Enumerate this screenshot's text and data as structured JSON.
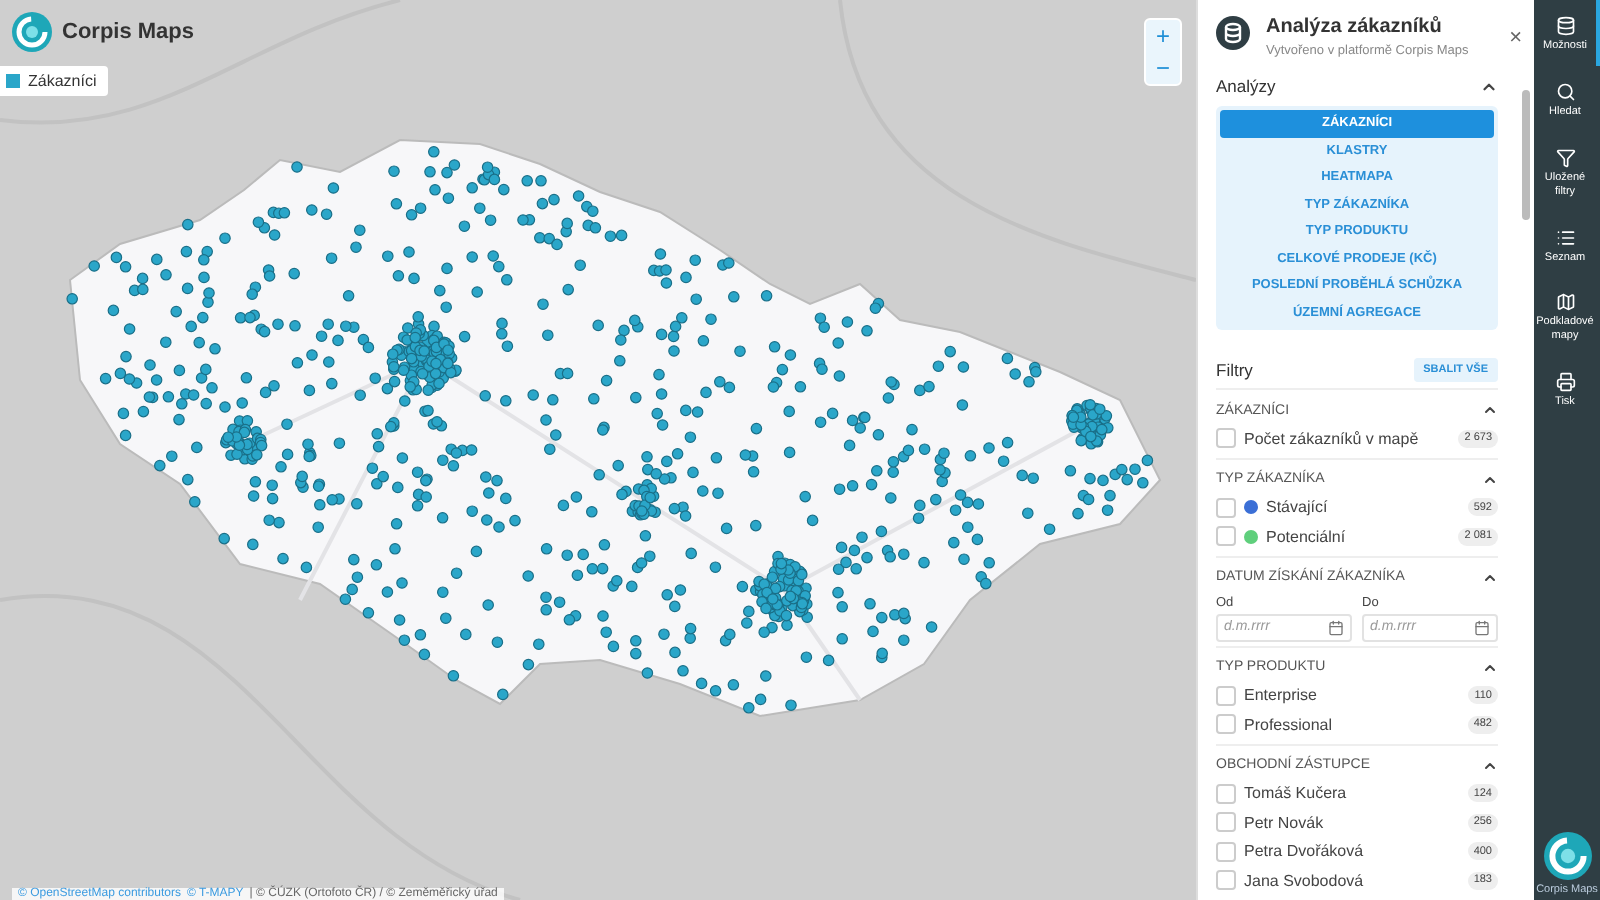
{
  "app": {
    "name": "Corpis Maps"
  },
  "legend": [
    {
      "label": "Zákazníci"
    }
  ],
  "zoom_controls": [
    "+",
    "−"
  ],
  "attribution": [
    {
      "text": "© OpenStreetMap contributors",
      "kind": "link"
    },
    {
      "text": "© T-MAPY",
      "kind": "link"
    },
    {
      "text": "| © ČÚZK (Ortofoto ČR) / © Zeměměřický úřad",
      "kind": "plain"
    }
  ],
  "panel": {
    "title": "Analýza zákazníků",
    "subtitle": "Vytvořeno v platformě Corpis Maps",
    "close": "×"
  },
  "analyses": {
    "title": "Analýzy",
    "expanded": true,
    "items": [
      {
        "label": "ZÁKAZNÍCI",
        "selected": true
      },
      {
        "label": "KLASTRY",
        "selected": false
      },
      {
        "label": "HEATMAPA",
        "selected": false
      },
      {
        "label": "TYP ZÁKAZNÍKA",
        "selected": false
      },
      {
        "label": "TYP PRODUKTU",
        "selected": false
      },
      {
        "label": "CELKOVÉ PRODEJE (KČ)",
        "selected": false
      },
      {
        "label": "POSLEDNÍ PROBĚHLÁ SCHŮZKA",
        "selected": false
      },
      {
        "label": "ÚZEMNÍ AGREGACE",
        "selected": false
      }
    ]
  },
  "filters": {
    "title": "Filtry",
    "collapse_all": "SBALIT VŠE",
    "groups": [
      {
        "kind": "checklist",
        "title": "ZÁKAZNÍCI",
        "expanded": true,
        "items": [
          {
            "label": "Počet zákazníků v mapě",
            "count": "2 673",
            "checked": false
          }
        ]
      },
      {
        "kind": "checklist",
        "title": "TYP ZÁKAZNÍKA",
        "expanded": true,
        "items": [
          {
            "label": "Stávající",
            "count": "592",
            "checked": false,
            "color": "#3b6fd6"
          },
          {
            "label": "Potenciální",
            "count": "2 081",
            "checked": false,
            "color": "#5fcf7c"
          }
        ]
      },
      {
        "kind": "dates",
        "title": "DATUM ZÍSKÁNÍ ZÁKAZNÍKA",
        "expanded": true,
        "fields": [
          {
            "label": "Od",
            "placeholder": "d.m.rrrr"
          },
          {
            "label": "Do",
            "placeholder": "d.m.rrrr"
          }
        ]
      },
      {
        "kind": "checklist",
        "title": "TYP PRODUKTU",
        "expanded": true,
        "items": [
          {
            "label": "Enterprise",
            "count": "110",
            "checked": false
          },
          {
            "label": "Professional",
            "count": "482",
            "checked": false
          }
        ]
      },
      {
        "kind": "checklist",
        "title": "OBCHODNÍ ZÁSTUPCE",
        "expanded": true,
        "items": [
          {
            "label": "Tomáš Kučera",
            "count": "124",
            "checked": false
          },
          {
            "label": "Petr Novák",
            "count": "256",
            "checked": false
          },
          {
            "label": "Petra Dvořáková",
            "count": "400",
            "checked": false
          },
          {
            "label": "Jana Svobodová",
            "count": "183",
            "checked": false
          }
        ]
      }
    ]
  },
  "sidebar": [
    {
      "label": "Možnosti",
      "selected": true
    },
    {
      "label": "Hledat",
      "selected": false
    },
    {
      "label": "Uložené filtry",
      "selected": false
    },
    {
      "label": "Seznam",
      "selected": false
    },
    {
      "label": "Podkladové mapy",
      "selected": false
    },
    {
      "label": "Tisk",
      "selected": false
    }
  ],
  "footer": {
    "label": "Corpis Maps"
  }
}
